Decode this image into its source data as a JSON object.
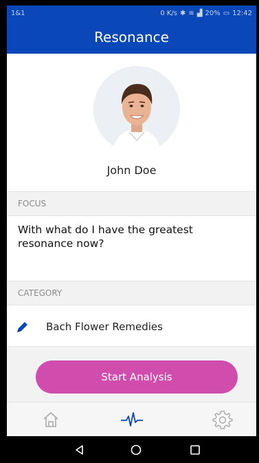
{
  "status": {
    "carrier": "1&1",
    "network_speed": "0 K/s",
    "battery": "20%",
    "time": "12:42"
  },
  "header": {
    "title": "Resonance"
  },
  "profile": {
    "name": "John Doe"
  },
  "focus": {
    "label": "FOCUS",
    "question": "With what do I have the greatest resonance now?"
  },
  "category": {
    "label": "CATEGORY",
    "value": "Bach Flower Remedies"
  },
  "actions": {
    "start_label": "Start Analysis"
  },
  "tabs": [
    {
      "name": "home",
      "icon": "home-icon",
      "active": false
    },
    {
      "name": "analysis",
      "icon": "pulse-icon",
      "active": true
    },
    {
      "name": "settings",
      "icon": "gear-icon",
      "active": false
    }
  ],
  "colors": {
    "primary": "#0a47b8",
    "accent": "#d04cad",
    "pencil": "#0a47b8"
  }
}
